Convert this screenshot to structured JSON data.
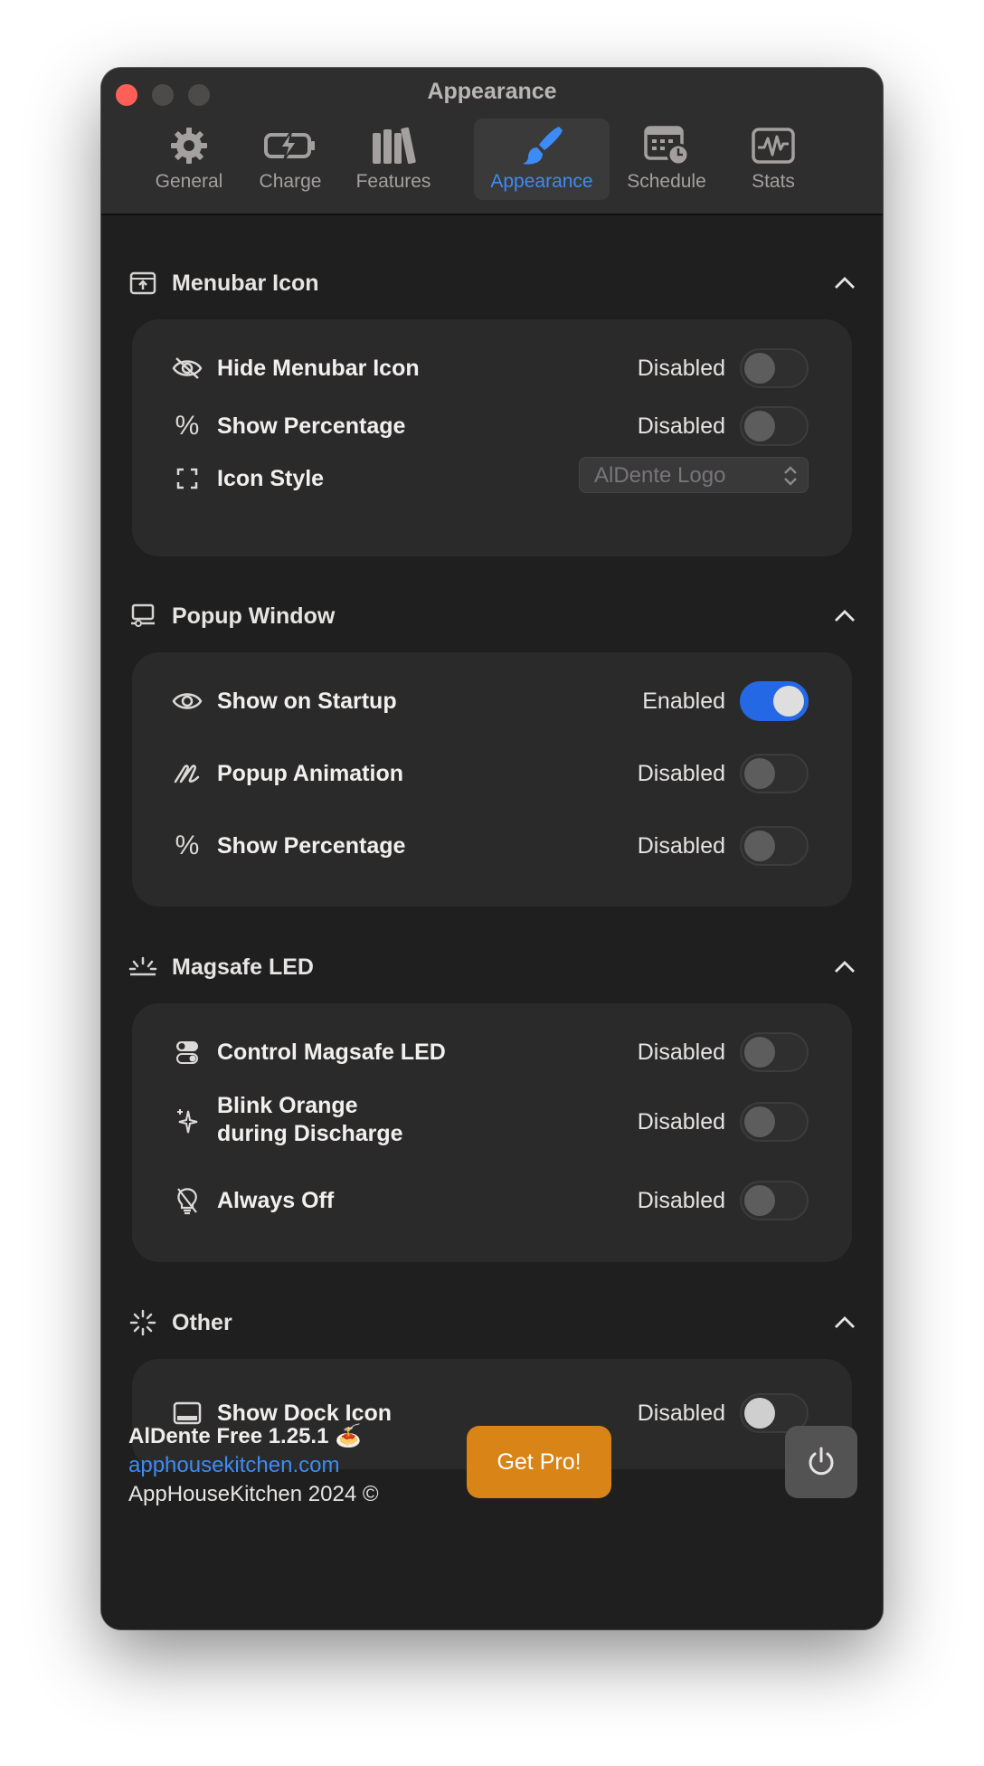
{
  "window": {
    "title": "Appearance"
  },
  "tabs": [
    {
      "label": "General",
      "icon": "gear-icon"
    },
    {
      "label": "Charge",
      "icon": "battery-charge-icon"
    },
    {
      "label": "Features",
      "icon": "books-icon"
    },
    {
      "label": "Appearance",
      "icon": "paintbrush-icon",
      "active": true
    },
    {
      "label": "Schedule",
      "icon": "calendar-clock-icon"
    },
    {
      "label": "Stats",
      "icon": "waveform-icon"
    }
  ],
  "sections": {
    "menubar": {
      "title": "Menubar Icon",
      "rows": [
        {
          "label": "Hide Menubar Icon",
          "state": "Disabled"
        },
        {
          "label": "Show Percentage",
          "state": "Disabled"
        },
        {
          "label": "Icon Style",
          "value": "AlDente Logo"
        }
      ]
    },
    "popup": {
      "title": "Popup Window",
      "rows": [
        {
          "label": "Show on Startup",
          "state": "Enabled"
        },
        {
          "label": "Popup Animation",
          "state": "Disabled"
        },
        {
          "label": "Show Percentage",
          "state": "Disabled"
        }
      ]
    },
    "magsafe": {
      "title": "Magsafe LED",
      "rows": [
        {
          "label": "Control Magsafe LED",
          "state": "Disabled"
        },
        {
          "label_line1": "Blink Orange",
          "label_line2": "during Discharge",
          "state": "Disabled"
        },
        {
          "label": "Always Off",
          "state": "Disabled"
        }
      ]
    },
    "other": {
      "title": "Other",
      "rows": [
        {
          "label": "Show Dock Icon",
          "state": "Disabled"
        }
      ]
    }
  },
  "footer": {
    "app_version": "AlDente Free 1.25.1 🍝",
    "link": "apphousekitchen.com",
    "copyright": "AppHouseKitchen 2024 ©",
    "pro_button": "Get Pro!"
  },
  "colors": {
    "accent": "#3d8bf5",
    "toggle_on": "#2568e6",
    "pro": "#d88417",
    "close": "#ff5f57"
  }
}
